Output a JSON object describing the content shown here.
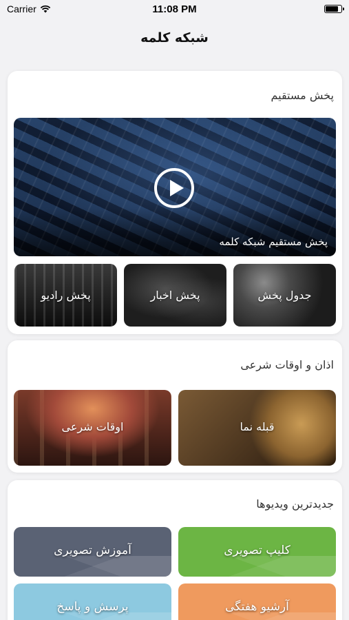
{
  "status_bar": {
    "carrier": "Carrier",
    "time": "11:08 PM",
    "battery_level": 0.85
  },
  "nav": {
    "title": "شبکه کلمه"
  },
  "live_section": {
    "title": "پخش مستقیم",
    "hero_label": "پخش مستقیم شبکه کلمه",
    "tiles": [
      {
        "label": "جدول پخش"
      },
      {
        "label": "پخش اخبار"
      },
      {
        "label": "پخش رادیو"
      }
    ]
  },
  "prayer_section": {
    "title": "اذان و اوقات شرعی",
    "tiles": [
      {
        "label": "قبله نما"
      },
      {
        "label": "اوقات شرعی"
      }
    ]
  },
  "videos_section": {
    "title": "جدیدترین ویدیوها",
    "tiles": [
      {
        "label": "کلیپ تصویری",
        "color": "#6cb544"
      },
      {
        "label": "آموزش تصویری",
        "color": "#5a6274"
      },
      {
        "label": "آرشیو هفتگی",
        "color": "#ef9a5e"
      },
      {
        "label": "پرسش و پاسخ",
        "color": "#8dc9e0"
      }
    ]
  }
}
